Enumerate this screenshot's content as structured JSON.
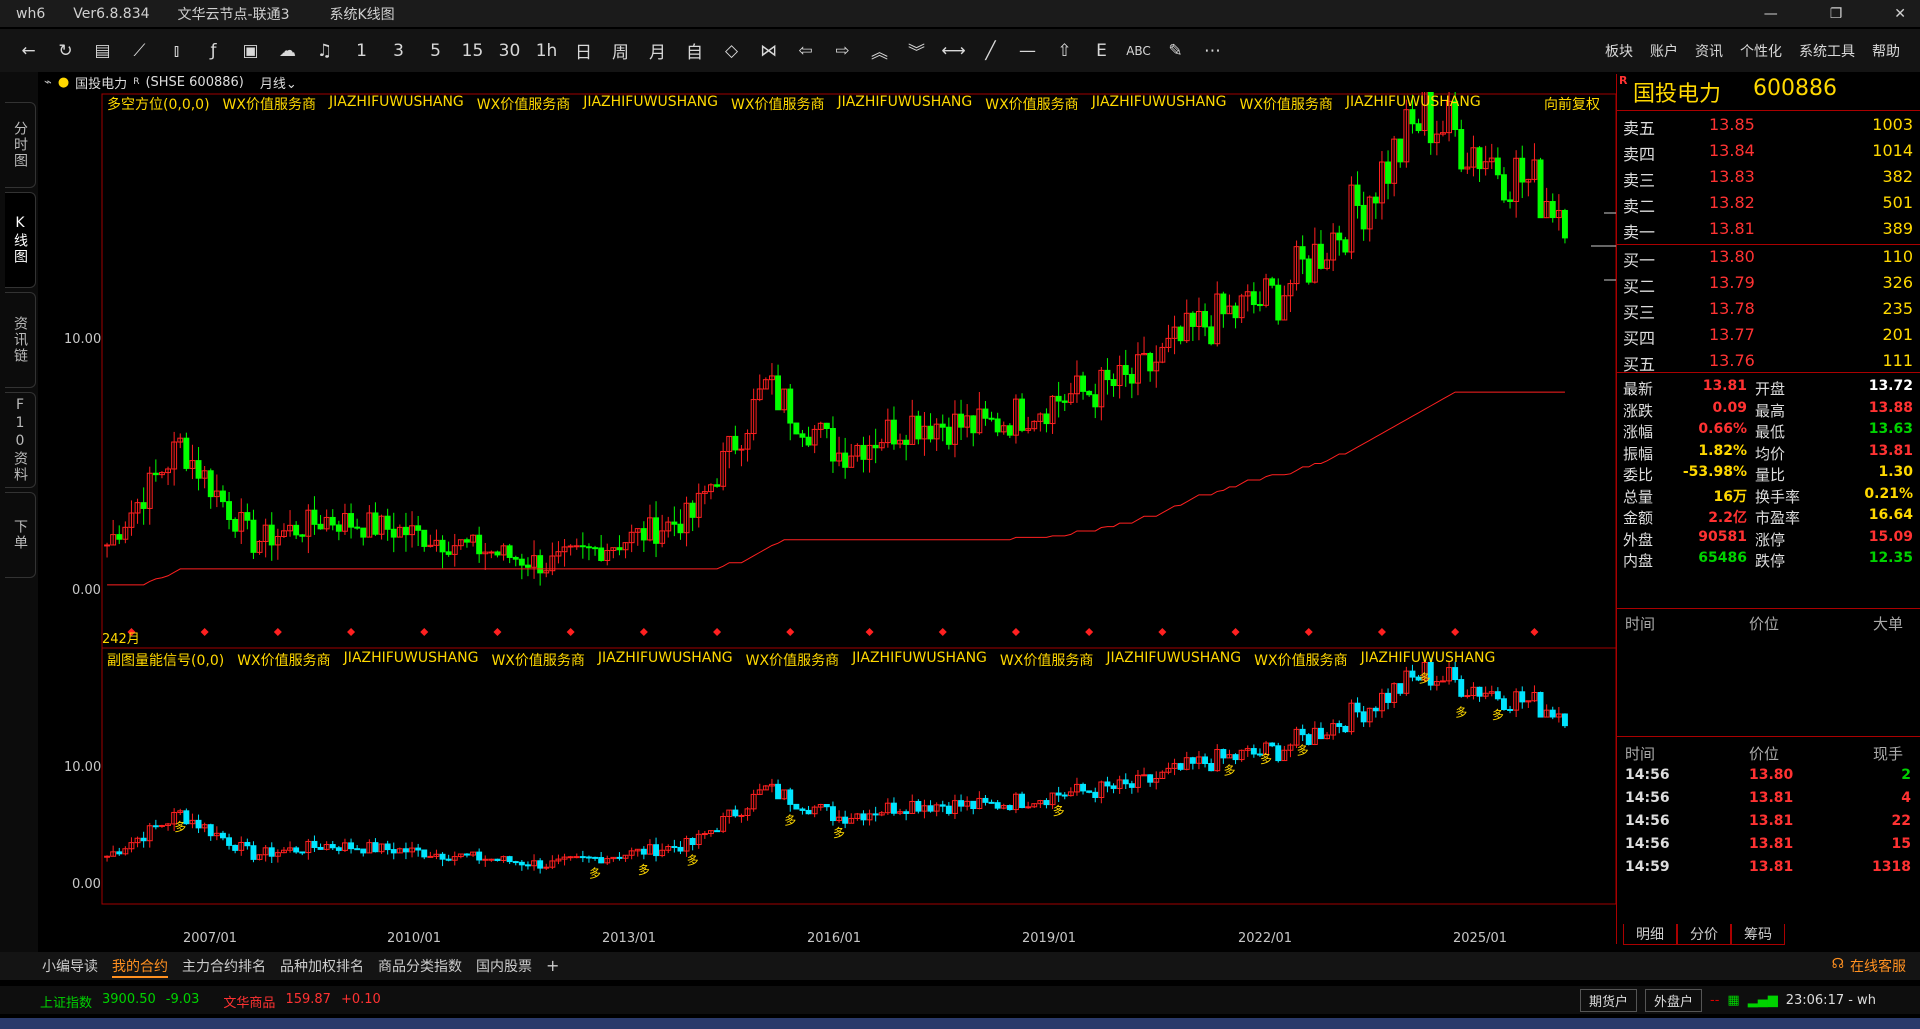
{
  "window": {
    "title": "wh6",
    "version": "Ver6.8.834",
    "server": "文华云节点-联通3",
    "view": "系统K线图"
  },
  "toolbar": {
    "buttons": [
      "1",
      "3",
      "5",
      "15",
      "30",
      "1h",
      "日",
      "周",
      "月",
      "自"
    ],
    "menus": [
      "板块",
      "账户",
      "资讯",
      "个性化",
      "系统工具",
      "帮助"
    ]
  },
  "left_tabs": [
    "分时图",
    "K线图",
    "资讯链",
    "F10资料",
    "下单"
  ],
  "chart_header": {
    "symbol": "国投电力",
    "symbol_suffix": "R",
    "code": "(SHSE 600886)",
    "period": "月线",
    "main_indicator": "多空方位(0,0,0)",
    "watermark_a": "WX价值服务商",
    "watermark_b": "JIAZHIFUWUSHANG",
    "adjust": "向前复权",
    "sub_indicator": "副图量能信号(0,0)",
    "bar_count": "242月",
    "signal_char": "多"
  },
  "axis": {
    "main_y": [
      "10.00",
      "0.00"
    ],
    "sub_y": [
      "10.00",
      "0.00"
    ],
    "x_ticks": [
      "2007/01",
      "2010/01",
      "2013/01",
      "2016/01",
      "2019/01",
      "2022/01",
      "2025/01"
    ]
  },
  "quote": {
    "name": "国投电力",
    "code": "600886",
    "badge": "R",
    "asks": [
      {
        "label": "卖五",
        "price": "13.85",
        "vol": "1003"
      },
      {
        "label": "卖四",
        "price": "13.84",
        "vol": "1014"
      },
      {
        "label": "卖三",
        "price": "13.83",
        "vol": "382"
      },
      {
        "label": "卖二",
        "price": "13.82",
        "vol": "501"
      },
      {
        "label": "卖一",
        "price": "13.81",
        "vol": "389"
      }
    ],
    "bids": [
      {
        "label": "买一",
        "price": "13.80",
        "vol": "110"
      },
      {
        "label": "买二",
        "price": "13.79",
        "vol": "326"
      },
      {
        "label": "买三",
        "price": "13.78",
        "vol": "235"
      },
      {
        "label": "买四",
        "price": "13.77",
        "vol": "201"
      },
      {
        "label": "买五",
        "price": "13.76",
        "vol": "111"
      }
    ],
    "stats": [
      {
        "l1": "最新",
        "v1": "13.81",
        "c1": "red",
        "l2": "开盘",
        "v2": "13.72",
        "c2": "white"
      },
      {
        "l1": "涨跌",
        "v1": "0.09",
        "c1": "red",
        "l2": "最高",
        "v2": "13.88",
        "c2": "red"
      },
      {
        "l1": "涨幅",
        "v1": "0.66%",
        "c1": "red",
        "l2": "最低",
        "v2": "13.63",
        "c2": "green"
      },
      {
        "l1": "振幅",
        "v1": "1.82%",
        "c1": "yellow",
        "l2": "均价",
        "v2": "13.81",
        "c2": "red"
      },
      {
        "l1": "委比",
        "v1": "-53.98%",
        "c1": "yellow",
        "l2": "量比",
        "v2": "1.30",
        "c2": "yellow"
      },
      {
        "l1": "总量",
        "v1": "16万",
        "c1": "yellow",
        "l2": "换手率",
        "v2": "0.21%",
        "c2": "yellow"
      },
      {
        "l1": "金额",
        "v1": "2.2亿",
        "c1": "red",
        "l2": "市盈率",
        "v2": "16.64",
        "c2": "yellow"
      },
      {
        "l1": "外盘",
        "v1": "90581",
        "c1": "red",
        "l2": "涨停",
        "v2": "15.09",
        "c2": "red"
      },
      {
        "l1": "内盘",
        "v1": "65486",
        "c1": "green",
        "l2": "跌停",
        "v2": "12.35",
        "c2": "green"
      }
    ],
    "table1_headers": [
      "时间",
      "价位",
      "大单"
    ],
    "table2_headers": [
      "时间",
      "价位",
      "现手"
    ],
    "ticks": [
      {
        "time": "14:56",
        "price": "13.80",
        "vol": "2",
        "vc": "green"
      },
      {
        "time": "14:56",
        "price": "13.81",
        "vol": "4",
        "vc": "red"
      },
      {
        "time": "14:56",
        "price": "13.81",
        "vol": "22",
        "vc": "red"
      },
      {
        "time": "14:56",
        "price": "13.81",
        "vol": "15",
        "vc": "red"
      },
      {
        "time": "14:59",
        "price": "13.81",
        "vol": "1318",
        "vc": "red"
      }
    ],
    "bottom_tabs": [
      "明细",
      "分价",
      "筹码"
    ]
  },
  "bottom_tabs": [
    "小编导读",
    "我的合约",
    "主力合约排名",
    "品种加权排名",
    "商品分类指数",
    "国内股票"
  ],
  "bottom_add": "+",
  "service": "在线客服",
  "status": {
    "idx1_name": "上证指数",
    "idx1_val": "3900.50",
    "idx1_chg": "-9.03",
    "idx2_name": "文华商品",
    "idx2_val": "159.87",
    "idx2_chg": "+0.10",
    "btn1": "期货户",
    "btn2": "外盘户",
    "clock": "23:06:17 - wh"
  },
  "chart_data": {
    "type": "candlestick",
    "title": "国投电力 (SHSE 600886) 月线",
    "x_range": [
      "2006/01",
      "2025/12"
    ],
    "ylim_main": [
      0,
      16
    ],
    "ylim_sub": [
      0,
      16
    ],
    "annual_close": [
      {
        "x": "2006",
        "y": 0.5
      },
      {
        "x": "2007",
        "y": 4.0
      },
      {
        "x": "2008",
        "y": 0.6
      },
      {
        "x": "2009",
        "y": 1.4
      },
      {
        "x": "2010",
        "y": 1.0
      },
      {
        "x": "2011",
        "y": 0.4
      },
      {
        "x": "2012",
        "y": -0.2
      },
      {
        "x": "2013",
        "y": 0.6
      },
      {
        "x": "2014",
        "y": 1.5
      },
      {
        "x": "2015",
        "y": 6.0
      },
      {
        "x": "2016",
        "y": 3.7
      },
      {
        "x": "2017",
        "y": 4.8
      },
      {
        "x": "2018",
        "y": 4.6
      },
      {
        "x": "2019",
        "y": 5.6
      },
      {
        "x": "2020",
        "y": 6.2
      },
      {
        "x": "2021",
        "y": 8.2
      },
      {
        "x": "2022",
        "y": 9.2
      },
      {
        "x": "2023",
        "y": 12.0
      },
      {
        "x": "2024",
        "y": 15.5
      },
      {
        "x": "2025",
        "y": 13.81
      }
    ]
  }
}
